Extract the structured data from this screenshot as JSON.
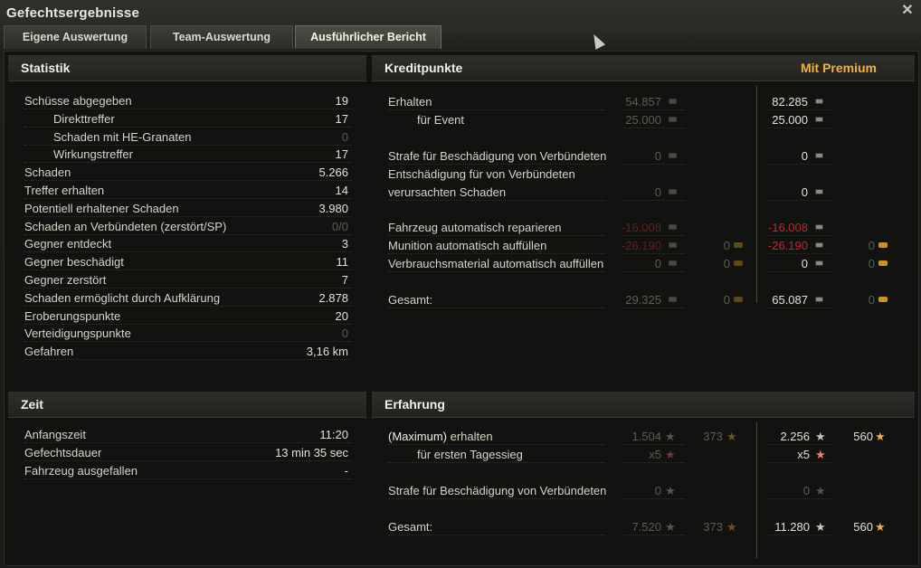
{
  "window": {
    "title": "Gefechtsergebnisse"
  },
  "tabs": [
    {
      "label": "Eigene Auswertung"
    },
    {
      "label": "Team-Auswertung"
    },
    {
      "label": "Ausführlicher Bericht"
    }
  ],
  "statistik": {
    "title": "Statistik",
    "rows": [
      {
        "label": "Schüsse abgegeben",
        "value": "19"
      },
      {
        "label": "Direkttreffer",
        "value": "17"
      },
      {
        "label": "Schaden mit HE-Granaten",
        "value": "0"
      },
      {
        "label": "Wirkungstreffer",
        "value": "17"
      },
      {
        "label": "Schaden",
        "value": "5.266"
      },
      {
        "label": "Treffer erhalten",
        "value": "14"
      },
      {
        "label": "Potentiell erhaltener Schaden",
        "value": "3.980"
      },
      {
        "label": "Schaden an Verbündeten (zerstört/SP)",
        "value": "0/0"
      },
      {
        "label": "Gegner entdeckt",
        "value": "3"
      },
      {
        "label": "Gegner beschädigt",
        "value": "11"
      },
      {
        "label": "Gegner zerstört",
        "value": "7"
      },
      {
        "label": "Schaden ermöglicht durch Aufklärung",
        "value": "2.878"
      },
      {
        "label": "Eroberungspunkte",
        "value": "20"
      },
      {
        "label": "Verteidigungspunkte",
        "value": "0"
      },
      {
        "label": "Gefahren",
        "value": "3,16 km"
      }
    ]
  },
  "zeit": {
    "title": "Zeit",
    "rows": [
      {
        "label": "Anfangszeit",
        "value": "11:20"
      },
      {
        "label": "Gefechtsdauer",
        "value": "13 min 35 sec"
      },
      {
        "label": "Fahrzeug ausgefallen",
        "value": "-"
      }
    ]
  },
  "kredit": {
    "title": "Kreditpunkte",
    "premium_label": "Mit Premium",
    "rows": [
      {
        "label": "Erhalten",
        "std": "54.857",
        "std_gold": "",
        "prem": "82.285",
        "prem_gold": ""
      },
      {
        "label": "für Event",
        "std": "25.000",
        "std_gold": "",
        "prem": "25.000",
        "prem_gold": ""
      },
      {
        "label": "Strafe für Beschädigung von Verbündeten",
        "std": "0",
        "std_gold": "",
        "prem": "0",
        "prem_gold": ""
      },
      {
        "label": "Entschädigung für von Verbündeten",
        "std": "",
        "std_gold": "",
        "prem": "",
        "prem_gold": ""
      },
      {
        "label": "verursachten Schaden",
        "std": "0",
        "std_gold": "",
        "prem": "0",
        "prem_gold": ""
      },
      {
        "label": "Fahrzeug automatisch reparieren",
        "std": "-16.008",
        "std_gold": "",
        "prem": "-16.008",
        "prem_gold": ""
      },
      {
        "label": "Munition automatisch auffüllen",
        "std": "-26.190",
        "std_gold": "0",
        "prem": "-26.190",
        "prem_gold": "0"
      },
      {
        "label": "Verbrauchsmaterial automatisch auffüllen",
        "std": "0",
        "std_gold": "0",
        "prem": "0",
        "prem_gold": "0"
      },
      {
        "label": "Gesamt:",
        "std": "29.325",
        "std_gold": "0",
        "prem": "65.087",
        "prem_gold": "0"
      }
    ]
  },
  "erfahrung": {
    "title": "Erfahrung",
    "rows": [
      {
        "label_highlight": "(Maximum)",
        "label": " erhalten",
        "std": "1.504",
        "std_free": "373",
        "prem": "2.256",
        "prem_free": "560"
      },
      {
        "label": "für ersten Tagessieg",
        "std": "x5",
        "prem": "x5"
      },
      {
        "label": "Strafe für Beschädigung von Verbündeten",
        "std": "0",
        "prem": "0"
      },
      {
        "label": "Gesamt:",
        "std": "7.520",
        "std_free": "373",
        "prem": "11.280",
        "prem_free": "560"
      }
    ]
  },
  "icons": {
    "credit": "credit-icon",
    "gold": "gold-icon",
    "xp": "xp-star-icon",
    "free_xp": "free-xp-star-icon"
  },
  "colors": {
    "premium": "#f2b23a",
    "negative": "#c0262a",
    "free_xp_star": "#f0b040"
  }
}
